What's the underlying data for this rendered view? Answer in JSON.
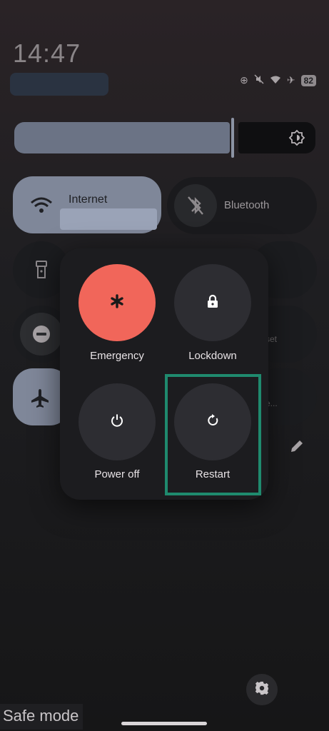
{
  "status": {
    "time": "14:47",
    "battery": "82"
  },
  "tiles": {
    "internet_label": "Internet",
    "bluetooth_label": "Bluetooth",
    "partial_label_1": "set",
    "partial_label_2": "e..."
  },
  "power_menu": {
    "emergency_label": "Emergency",
    "lockdown_label": "Lockdown",
    "power_off_label": "Power off",
    "restart_label": "Restart"
  },
  "footer": {
    "safe_mode_label": "Safe mode"
  },
  "colors": {
    "emergency_red": "#f1665a",
    "highlight_green": "#1f8a6e",
    "active_tile": "#7f8799"
  },
  "icons": [
    "wifi-icon",
    "bluetooth-off-icon",
    "flashlight-icon",
    "dnd-icon",
    "airplane-icon",
    "brightness-icon",
    "edit-icon",
    "asterisk-icon",
    "lock-icon",
    "power-icon",
    "restart-icon",
    "gear-icon"
  ]
}
